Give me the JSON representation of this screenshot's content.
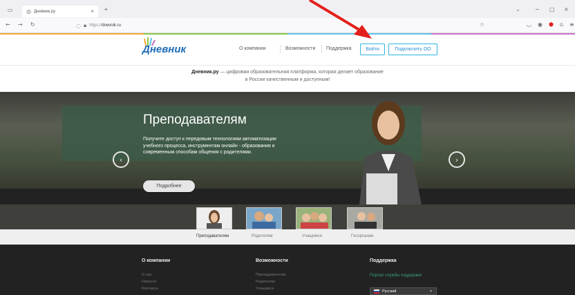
{
  "browser": {
    "tab_title": "Дневник.ру",
    "tab_close": "×",
    "new_tab": "+",
    "url_prefix": "https://",
    "url_host": "dnevnik.ru"
  },
  "header": {
    "logo_text": "Дневник",
    "nav": [
      "О компании",
      "Возможности",
      "Поддержка"
    ],
    "login_label": "Войти",
    "connect_label": "Подключить ОО"
  },
  "tagline": {
    "brand": "Дневник.ру",
    "line1": " — цифровая образовательная платформа, которая делает образование",
    "line2": "в России качественным и доступным!"
  },
  "hero": {
    "title": "Преподавателям",
    "text": "Получите доступ к передовым технологиям автоматизации учебного процесса, инструментам онлайн - образования и современным способам общения с родителями.",
    "more_label": "Подробнее",
    "prev": "‹",
    "next": "›"
  },
  "thumbs": {
    "captions": [
      "Преподавателям",
      "Родителям",
      "Учащимся",
      "Госорганам"
    ]
  },
  "footer": {
    "col1_title": "О компании",
    "col1_links": [
      "О нас",
      "Новости",
      "Контакты"
    ],
    "col2_title": "Возможности",
    "col2_links": [
      "Преподавателям",
      "Родителям",
      "Учащимся"
    ],
    "col3_title": "Поддержка",
    "support_link": "Портал службы поддержки",
    "language": "Русский"
  },
  "colors": {
    "accent": "#2bb5e3",
    "annotation_arrow": "#e3201b"
  }
}
